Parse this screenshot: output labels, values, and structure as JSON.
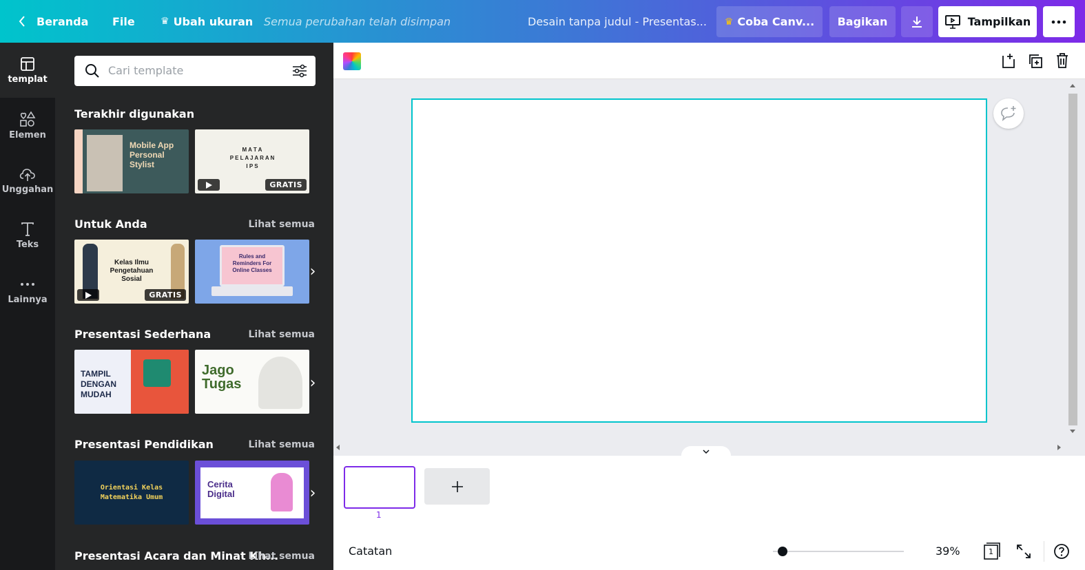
{
  "topbar": {
    "home_label": "Beranda",
    "file_label": "File",
    "resize_label": "Ubah ukuran",
    "save_status": "Semua perubahan telah disimpan",
    "doc_title": "Desain tanpa judul - Presentas...",
    "try_pro_label": "Coba Canv...",
    "share_label": "Bagikan",
    "present_label": "Tampilkan"
  },
  "sidenav": {
    "items": [
      {
        "label": "templat",
        "icon": "template-icon",
        "active": true
      },
      {
        "label": "Elemen",
        "icon": "elements-icon"
      },
      {
        "label": "Unggahan",
        "icon": "upload-cloud-icon"
      },
      {
        "label": "Teks",
        "icon": "text-icon"
      },
      {
        "label": "Lainnya",
        "icon": "more-dots-icon"
      }
    ]
  },
  "panel": {
    "search_placeholder": "Cari template",
    "see_all_label": "Lihat semua",
    "sections": [
      {
        "title": "Terakhir digunakan"
      },
      {
        "title": "Untuk Anda"
      },
      {
        "title": "Presentasi Sederhana"
      },
      {
        "title": "Presentasi Pendidikan"
      },
      {
        "title": "Presentasi Acara dan Minat Kh..."
      }
    ],
    "free_badge": "GRATIS",
    "thumbs": {
      "t1": {
        "line1": "Mobile App",
        "line2": "Personal",
        "line3": "Stylist"
      },
      "t2": {
        "line1": "M A T A",
        "line2": "P E L A J A R A N",
        "line3": "I P S"
      },
      "t3": {
        "line1": "Kelas Ilmu",
        "line2": "Pengetahuan",
        "line3": "Sosial"
      },
      "t4": {
        "line1": "Rules and",
        "line2": "Reminders For",
        "line3": "Online Classes"
      },
      "t5": {
        "line1": "TAMPIL",
        "line2": "DENGAN",
        "line3": "MUDAH"
      },
      "t6": {
        "line1": "Jago",
        "line2": "Tugas"
      },
      "t7": {
        "line1": "Orientasi Kelas",
        "line2": "Matematika Umum"
      },
      "t8": {
        "line1": "Cerita",
        "line2": "Digital"
      }
    }
  },
  "editor": {
    "page_number": "1",
    "notes_label": "Catatan",
    "zoom_value": "39%",
    "zoom_fraction": 0.04,
    "page_count": "1"
  },
  "colors": {
    "accent": "#00c4cc",
    "purple": "#7d2ae8",
    "dark_panel": "#252627",
    "dark_nav": "#18191b"
  }
}
